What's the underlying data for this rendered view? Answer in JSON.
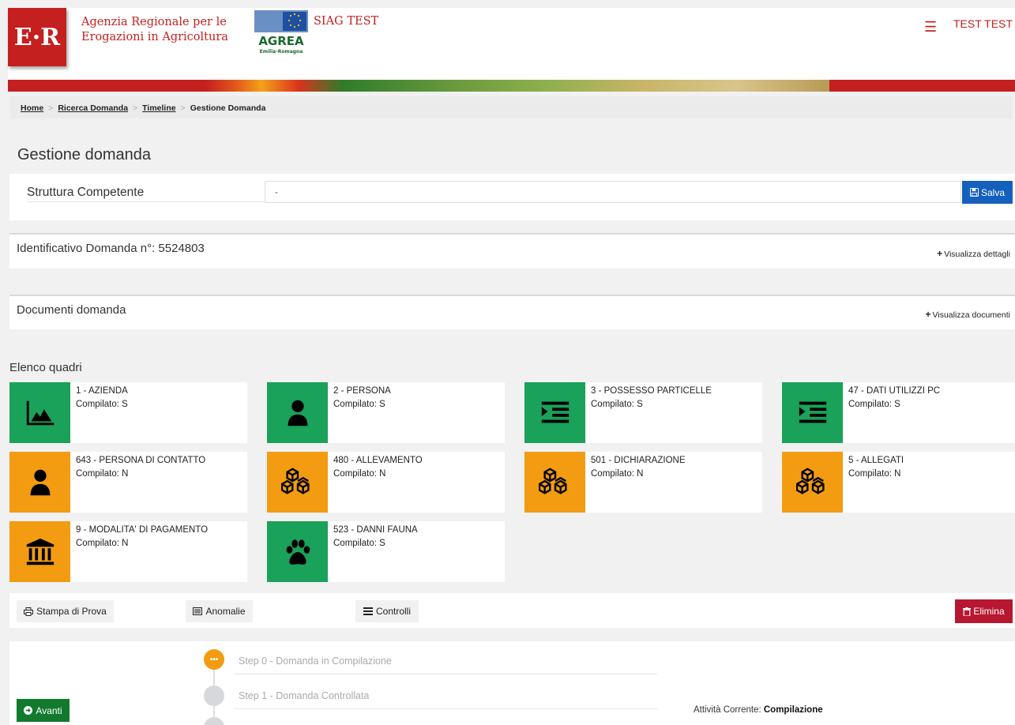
{
  "header": {
    "logo_text": "E·R",
    "agency_line1": "Agenzia Regionale per le",
    "agency_line2": "Erogazioni in Agricoltura",
    "agrea_logo_text": "AGREA",
    "agrea_logo_sub": "Emilia-Romagna",
    "system_name": "SIAG TEST",
    "menu_icon": "hamburger-icon",
    "user_name": "TEST TEST"
  },
  "breadcrumb": {
    "items": [
      "Home",
      "Ricerca Domanda",
      "Timeline"
    ],
    "current": "Gestione Domanda",
    "separator": ">"
  },
  "page_title": "Gestione domanda",
  "struttura": {
    "label": "Struttura Competente",
    "value": "-",
    "save_label": "Salva"
  },
  "identificativo": {
    "title": "Identificativo Domanda n°: 5524803",
    "link": "Visualizza dettagli"
  },
  "documenti": {
    "title": "Documenti domanda",
    "link": "Visualizza documenti"
  },
  "elenco_title": "Elenco quadri",
  "colors": {
    "brand_red": "#c4201f",
    "complete_green": "#1aa15a",
    "incomplete_orange": "#f39c12",
    "save_blue": "#1560bd",
    "delete_red": "#b81731",
    "next_green": "#117a2c"
  },
  "quadri": [
    {
      "name": "1 - AZIENDA",
      "status": "Compilato: S",
      "color": "#1aa15a",
      "icon": "area-chart-icon"
    },
    {
      "name": "2 - PERSONA",
      "status": "Compilato: S",
      "color": "#1aa15a",
      "icon": "user-icon"
    },
    {
      "name": "3 - POSSESSO PARTICELLE",
      "status": "Compilato: S",
      "color": "#1aa15a",
      "icon": "indent-list-icon"
    },
    {
      "name": "47 - DATI UTILIZZI PC",
      "status": "Compilato: S",
      "color": "#1aa15a",
      "icon": "indent-list-icon"
    },
    {
      "name": "643 - PERSONA DI CONTATTO",
      "status": "Compilato: N",
      "color": "#f39c12",
      "icon": "user-icon"
    },
    {
      "name": "480 - ALLEVAMENTO",
      "status": "Compilato: N",
      "color": "#f39c12",
      "icon": "cubes-icon"
    },
    {
      "name": "501 - DICHIARAZIONE",
      "status": "Compilato: N",
      "color": "#f39c12",
      "icon": "cubes-icon"
    },
    {
      "name": "5 - ALLEGATI",
      "status": "Compilato: N",
      "color": "#f39c12",
      "icon": "cubes-icon"
    },
    {
      "name": "9 - MODALITA' DI PAGAMENTO",
      "status": "Compilato: N",
      "color": "#f39c12",
      "icon": "bank-icon"
    },
    {
      "name": "523 - DANNI FAUNA",
      "status": "Compilato: S",
      "color": "#1aa15a",
      "icon": "paw-icon"
    }
  ],
  "actions": {
    "print_label": "Stampa di Prova",
    "anomalies_label": "Anomalie",
    "controls_label": "Controlli",
    "delete_label": "Elimina"
  },
  "workflow": {
    "steps": [
      {
        "label": "Step 0 - Domanda in Compilazione",
        "active": true
      },
      {
        "label": "Step 1 - Domanda Controllata",
        "active": false
      }
    ],
    "next_label": "Avanti",
    "current_activity_label": "Attività Corrente:",
    "current_activity_value": "Compilazione"
  }
}
